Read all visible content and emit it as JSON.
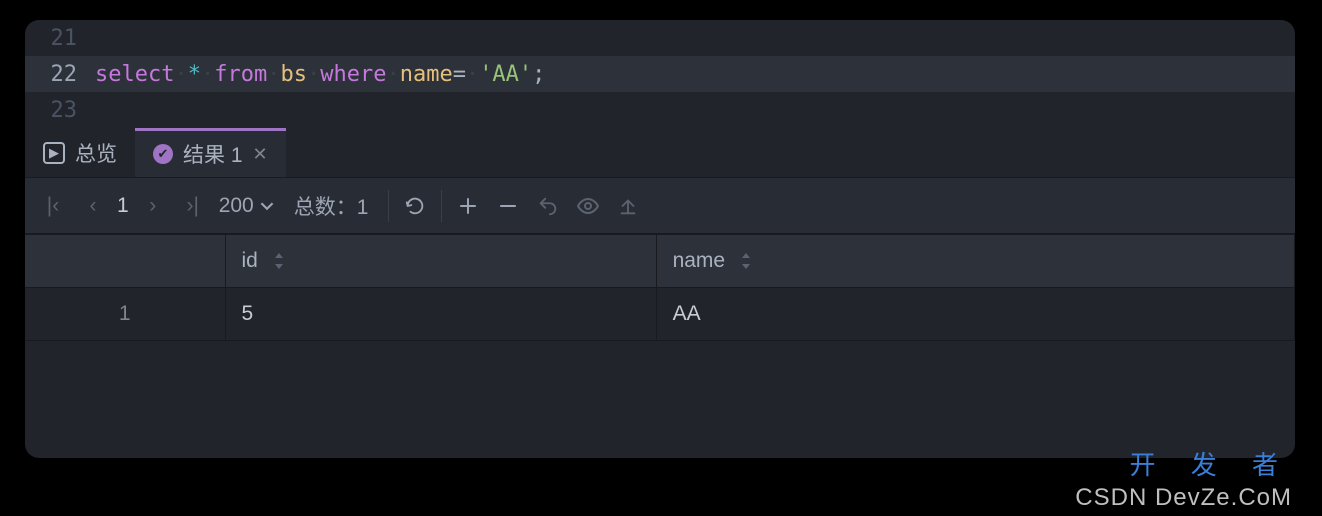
{
  "editor": {
    "lines": [
      {
        "num": "21"
      },
      {
        "num": "22"
      },
      {
        "num": "23"
      }
    ],
    "sql": {
      "kw_select": "select",
      "star": "*",
      "kw_from": "from",
      "table": "bs",
      "kw_where": "where",
      "col": "name",
      "eq": "=",
      "str": "'AA'",
      "semi": ";"
    }
  },
  "tabs": {
    "overview": "总览",
    "result": "结果 1"
  },
  "toolbar": {
    "page_num": "1",
    "page_size": "200",
    "total_label": "总数：",
    "total_value": "1"
  },
  "table": {
    "columns": [
      "id",
      "name"
    ],
    "rows": [
      {
        "rownum": "1",
        "id": "5",
        "name": "AA"
      }
    ]
  },
  "watermark": {
    "line1": "开 发 者",
    "line2": "CSDN DevZe.CoM"
  }
}
